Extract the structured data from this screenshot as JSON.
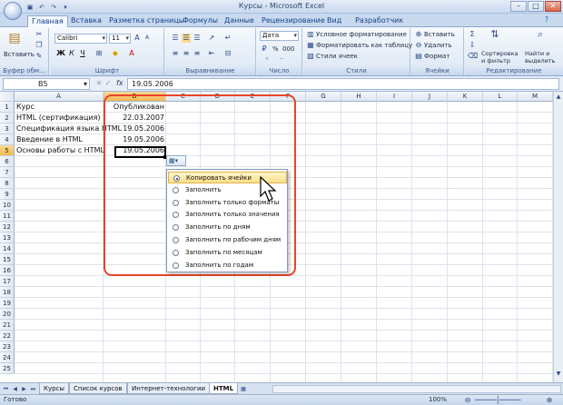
{
  "window": {
    "title": "Курсы - Microsoft Excel"
  },
  "ribbon_tabs": [
    "Главная",
    "Вставка",
    "Разметка страницы",
    "Формулы",
    "Данные",
    "Рецензирование",
    "Вид",
    "Разработчик"
  ],
  "clipboard": {
    "paste_label": "Вставить",
    "group": "Буфер обм..."
  },
  "font": {
    "name": "Calibri",
    "size": "11",
    "group": "Шрифт"
  },
  "alignment": {
    "group": "Выравнивание"
  },
  "number": {
    "format": "Дата",
    "percent": "%",
    "thousands": "000",
    "group": "Число"
  },
  "styles": {
    "conditional": "Условное форматирование",
    "as_table": "Форматировать как таблицу",
    "cell_styles": "Стили ячеек",
    "group": "Стили"
  },
  "cells": {
    "insert": "Вставить",
    "delete": "Удалить",
    "format": "Формат",
    "group": "Ячейки"
  },
  "editing": {
    "sort": "Сортировка и фильтр",
    "find": "Найти и выделить",
    "group": "Редактирование"
  },
  "formula_bar": {
    "name_box": "B5",
    "fx": "fx",
    "value": "19.05.2006"
  },
  "columns": [
    "A",
    "B",
    "C",
    "D",
    "E",
    "F",
    "G",
    "H",
    "I",
    "J",
    "K",
    "L",
    "M"
  ],
  "rows": [
    "1",
    "2",
    "3",
    "4",
    "5",
    "6",
    "7",
    "8",
    "9",
    "10",
    "11",
    "12",
    "13",
    "14",
    "15",
    "16",
    "17",
    "18",
    "19",
    "20",
    "21",
    "22",
    "23",
    "24",
    "25"
  ],
  "cells_data": [
    {
      "a": "Курс",
      "b": "Опубликован"
    },
    {
      "a": "HTML (сертификация)",
      "b": "22.03.2007"
    },
    {
      "a": "Спецификация языка HTML",
      "b": "19.05.2006"
    },
    {
      "a": "Введение в HTML",
      "b": "19.05.2006"
    },
    {
      "a": "Основы работы с HTML",
      "b": "19.05.2006"
    }
  ],
  "autofill_menu": [
    {
      "label": "Копировать ячейки",
      "selected": true
    },
    {
      "label": "Заполнить",
      "selected": false
    },
    {
      "label": "Заполнить только форматы",
      "selected": false
    },
    {
      "label": "Заполнить только значения",
      "selected": false
    },
    {
      "label": "Заполнить по дням",
      "selected": false
    },
    {
      "label": "Заполнить по рабочим дням",
      "selected": false
    },
    {
      "label": "Заполнить по месяцам",
      "selected": false
    },
    {
      "label": "Заполнить по годам",
      "selected": false
    }
  ],
  "sheet_tabs": [
    "Курсы",
    "Список курсов",
    "Интернет-технологии",
    "HTML"
  ],
  "active_sheet": "HTML",
  "status": {
    "ready": "Готово",
    "zoom": "100%"
  }
}
